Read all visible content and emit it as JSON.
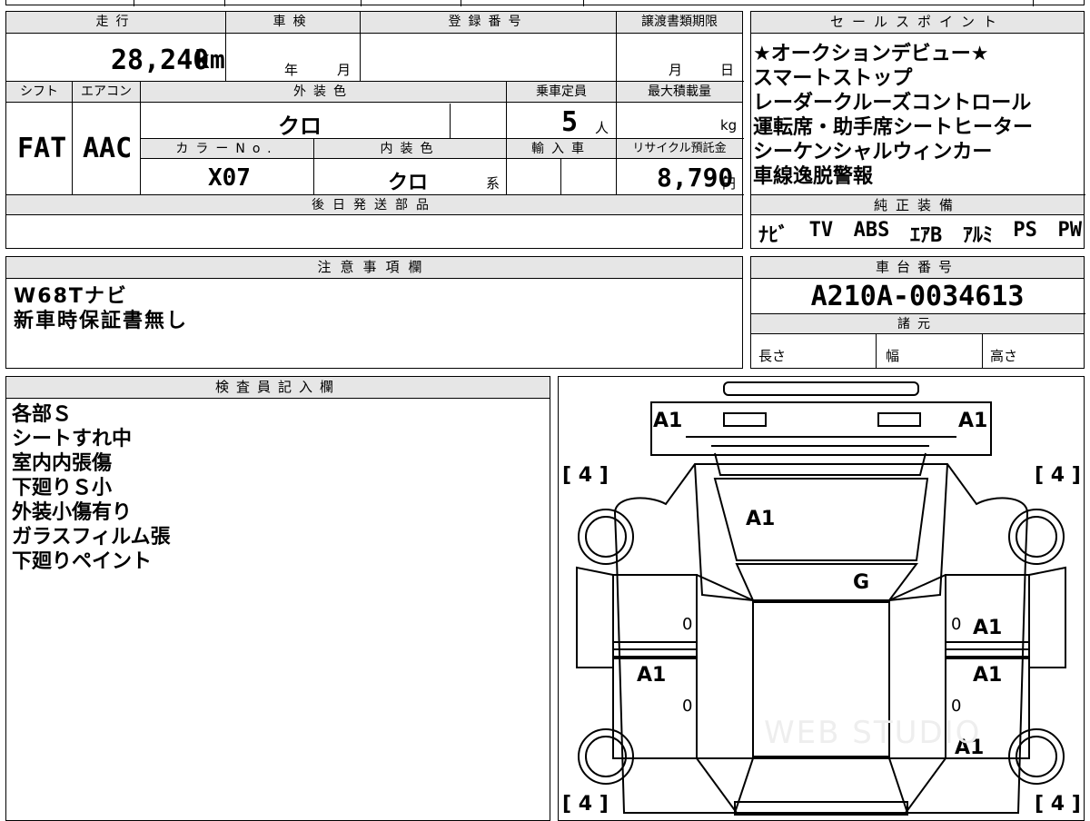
{
  "vehicle": {
    "mileage_label": "走行",
    "mileage": "28,240",
    "mileage_unit": "km",
    "inspection_label": "車検",
    "inspection_year": "年",
    "inspection_month": "月",
    "registration_label": "登録番号",
    "transfer_label": "譲渡書類期限",
    "transfer_month": "月",
    "transfer_day": "日",
    "shift_label": "シフト",
    "shift": "FAT",
    "ac_label": "エアコン",
    "ac": "AAC",
    "ext_color_label": "外装色",
    "ext_color": "クロ",
    "capacity_label": "乗車定員",
    "capacity": "5",
    "capacity_unit": "人",
    "max_load_label": "最大積載量",
    "max_load_unit": "kg",
    "color_no_label": "カラーNo.",
    "color_no": "X07",
    "int_color_label": "内装色",
    "int_color": "クロ",
    "int_color_suffix": "系",
    "import_label": "輸入車",
    "recycle_label": "リサイクル預託金",
    "recycle_fee": "8,790",
    "recycle_unit": "円",
    "later_parts_label": "後日発送部品"
  },
  "sales_points": {
    "label": "セールスポイント",
    "items": [
      "★オークションデビュー★",
      "スマートストップ",
      "レーダークルーズコントロール",
      "運転席・助手席シートヒーター",
      "シーケンシャルウィンカー",
      "車線逸脱警報"
    ]
  },
  "equipment": {
    "label": "純正装備",
    "items": [
      "ﾅﾋﾞ",
      "TV",
      "ABS",
      "ｴｱB",
      "ｱﾙﾐ",
      "PS",
      "PW"
    ]
  },
  "notes": {
    "label": "注意事項欄",
    "lines": [
      "W68Tナビ",
      "新車時保証書無し"
    ]
  },
  "chassis": {
    "label": "車台番号",
    "number": "A210A-0034613",
    "spec_label": "諸元",
    "length_label": "長さ",
    "width_label": "幅",
    "height_label": "高さ"
  },
  "inspector": {
    "label": "検査員記入欄",
    "lines": [
      "各部Ｓ",
      "シートすれ中",
      "室内内張傷",
      "下廻りＳ小",
      "外装小傷有り",
      "ガラスフィルム張",
      "下廻りペイント"
    ]
  },
  "diagram": {
    "marks": {
      "front_left": "A1",
      "front_right": "A1",
      "hood": "A1",
      "windshield": "G",
      "right_front_door": "A1",
      "left_rear_door": "A1",
      "right_rear_door": "A1",
      "right_rear_fender": "A1",
      "tire_fl": "4",
      "tire_fr": "4",
      "tire_rl": "4",
      "tire_rr": "4",
      "zero_1": "0",
      "zero_2": "0",
      "zero_3": "0",
      "zero_4": "0"
    },
    "watermark": "WEB STUDIO"
  }
}
